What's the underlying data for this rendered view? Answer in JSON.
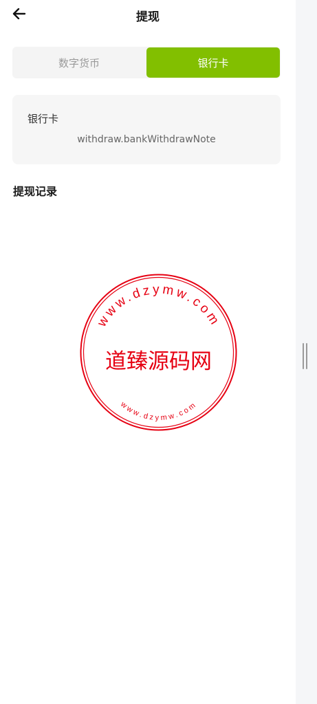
{
  "header": {
    "title": "提现",
    "back_icon": "arrow-left-icon"
  },
  "tabs": [
    {
      "label": "数字货币",
      "active": false
    },
    {
      "label": "银行卡",
      "active": true
    }
  ],
  "card": {
    "title": "银行卡",
    "note": "withdraw.bankWithdrawNote"
  },
  "records": {
    "title": "提现记录"
  },
  "watermark": {
    "center_text": "道臻源码网",
    "ring_text": "www.dzymw.com",
    "color": "#e60012"
  },
  "colors": {
    "accent": "#82bf00",
    "tab_bg": "#f4f4f4",
    "card_bg": "#f6f6f6"
  }
}
